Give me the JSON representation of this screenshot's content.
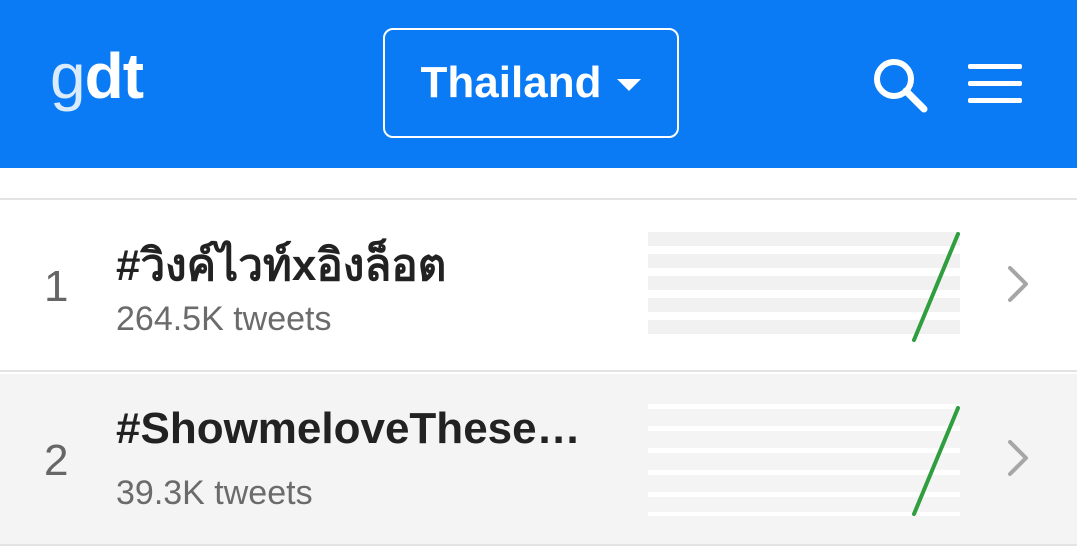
{
  "header": {
    "logo": {
      "light": "g",
      "bold": "dt"
    },
    "country_selector": {
      "label": "Thailand"
    },
    "icons": [
      "search-icon",
      "menu-icon"
    ]
  },
  "trends": [
    {
      "rank": "1",
      "name": "#วิงค์ไวท์xอิงล็อต",
      "count": "264.5K tweets"
    },
    {
      "rank": "2",
      "name": "#ShowmeloveThese…",
      "count": "39.3K tweets"
    }
  ],
  "colors": {
    "header_bg": "#0a7bf5",
    "sparkline": "#2e9e3e",
    "row_alt_bg": "#f4f4f4"
  }
}
